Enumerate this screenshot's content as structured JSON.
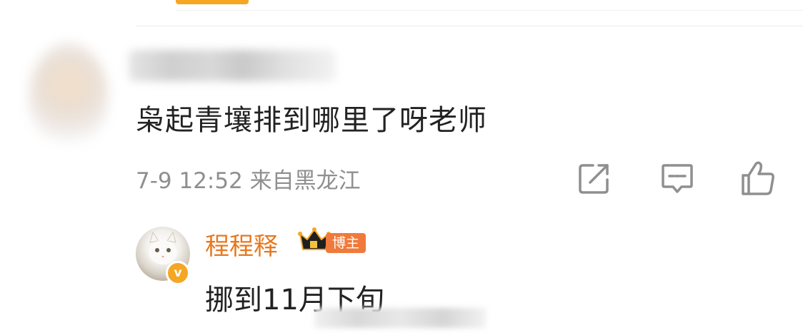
{
  "comment": {
    "text": "枭起青壤排到哪里了呀老师",
    "meta": "7-9 12:52 来自黑龙江"
  },
  "actions": {
    "share_icon": "share-icon",
    "comment_icon": "comment-icon",
    "like_icon": "thumbs-up-icon"
  },
  "reply": {
    "author": "程程释",
    "verified_icon": "verified-v-badge",
    "crown_icon": "crown-icon",
    "badge": "博主",
    "badge_color": "#f07a3c",
    "name_color": "#e8781d",
    "text": "挪到11月下旬"
  },
  "colors": {
    "accent": "#f5a623",
    "meta_text": "#8f8f8f",
    "body_text": "#222222"
  }
}
